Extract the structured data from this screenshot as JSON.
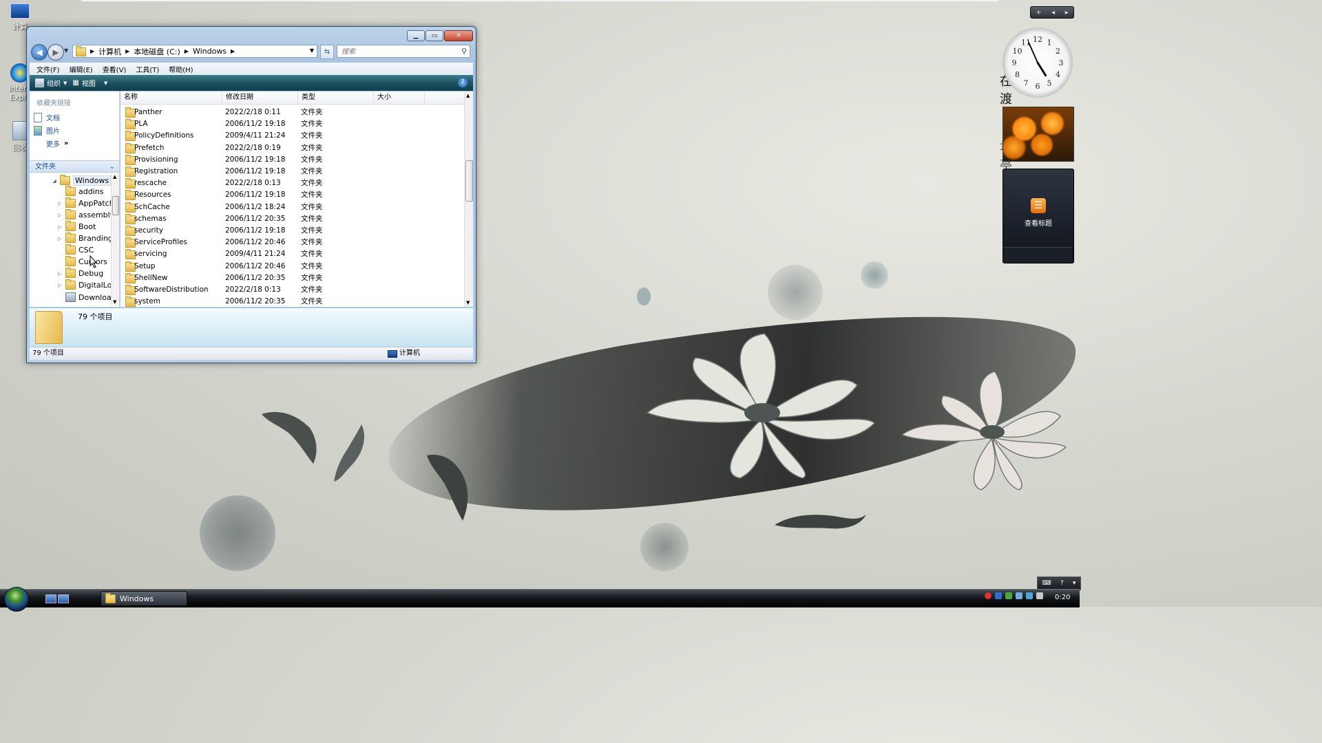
{
  "desktop": {
    "icons": [
      {
        "name": "computer",
        "label": "计算"
      },
      {
        "name": "internet-explorer",
        "label": "Intern Explo"
      },
      {
        "name": "recycle-bin",
        "label": "回收"
      }
    ],
    "calligraphy": [
      "在",
      "渡",
      "君",
      "亭"
    ]
  },
  "explorer": {
    "address": {
      "breadcrumbs": [
        "计算机",
        "本地磁盘 (C:)",
        "Windows"
      ]
    },
    "search": {
      "placeholder": "搜索"
    },
    "menu": [
      "文件(F)",
      "编辑(E)",
      "查看(V)",
      "工具(T)",
      "帮助(H)"
    ],
    "toolbar": {
      "organize": "组织",
      "views": "视图"
    },
    "favorites": {
      "title": "收藏夹链接",
      "items": [
        "文档",
        "图片"
      ],
      "more": "更多"
    },
    "folders_header": "文件夹",
    "tree": [
      {
        "label": "Windows",
        "expanded": true,
        "selected": true
      },
      {
        "label": "addins",
        "expandable": false
      },
      {
        "label": "AppPatch",
        "expandable": true
      },
      {
        "label": "assembly",
        "expandable": true
      },
      {
        "label": "Boot",
        "expandable": true
      },
      {
        "label": "Branding",
        "expandable": true
      },
      {
        "label": "CSC",
        "expandable": false
      },
      {
        "label": "Cursors",
        "expandable": false
      },
      {
        "label": "Debug",
        "expandable": true
      },
      {
        "label": "DigitalLoc",
        "expandable": true
      },
      {
        "label": "Download",
        "expandable": false
      }
    ],
    "columns": [
      "名称",
      "修改日期",
      "类型",
      "大小"
    ],
    "files": [
      {
        "name": "Panther",
        "date": "2022/2/18 0:11",
        "type": "文件夹",
        "size": ""
      },
      {
        "name": "PLA",
        "date": "2006/11/2 19:18",
        "type": "文件夹",
        "size": ""
      },
      {
        "name": "PolicyDefinitions",
        "date": "2009/4/11 21:24",
        "type": "文件夹",
        "size": ""
      },
      {
        "name": "Prefetch",
        "date": "2022/2/18 0:19",
        "type": "文件夹",
        "size": ""
      },
      {
        "name": "Provisioning",
        "date": "2006/11/2 19:18",
        "type": "文件夹",
        "size": ""
      },
      {
        "name": "Registration",
        "date": "2006/11/2 19:18",
        "type": "文件夹",
        "size": ""
      },
      {
        "name": "rescache",
        "date": "2022/2/18 0:13",
        "type": "文件夹",
        "size": ""
      },
      {
        "name": "Resources",
        "date": "2006/11/2 19:18",
        "type": "文件夹",
        "size": ""
      },
      {
        "name": "SchCache",
        "date": "2006/11/2 18:24",
        "type": "文件夹",
        "size": ""
      },
      {
        "name": "schemas",
        "date": "2006/11/2 20:35",
        "type": "文件夹",
        "size": ""
      },
      {
        "name": "security",
        "date": "2006/11/2 19:18",
        "type": "文件夹",
        "size": ""
      },
      {
        "name": "ServiceProfiles",
        "date": "2006/11/2 20:46",
        "type": "文件夹",
        "size": ""
      },
      {
        "name": "servicing",
        "date": "2009/4/11 21:24",
        "type": "文件夹",
        "size": ""
      },
      {
        "name": "Setup",
        "date": "2006/11/2 20:46",
        "type": "文件夹",
        "size": ""
      },
      {
        "name": "ShellNew",
        "date": "2006/11/2 20:35",
        "type": "文件夹",
        "size": ""
      },
      {
        "name": "SoftwareDistribution",
        "date": "2022/2/18 0:13",
        "type": "文件夹",
        "size": ""
      },
      {
        "name": "system",
        "date": "2006/11/2 20:35",
        "type": "文件夹",
        "size": ""
      }
    ],
    "details_count": "79 个项目",
    "status": {
      "left": "79 个项目",
      "right": "计算机"
    }
  },
  "sidebar": {
    "clock_time": "4:56",
    "feed_label": "查看标题"
  },
  "taskbar": {
    "task_label": "Windows",
    "clock": "0:20"
  },
  "colors": {
    "accent": "#1f4f9a",
    "command_bar": "#1e5361",
    "close_button": "#c8462c"
  }
}
